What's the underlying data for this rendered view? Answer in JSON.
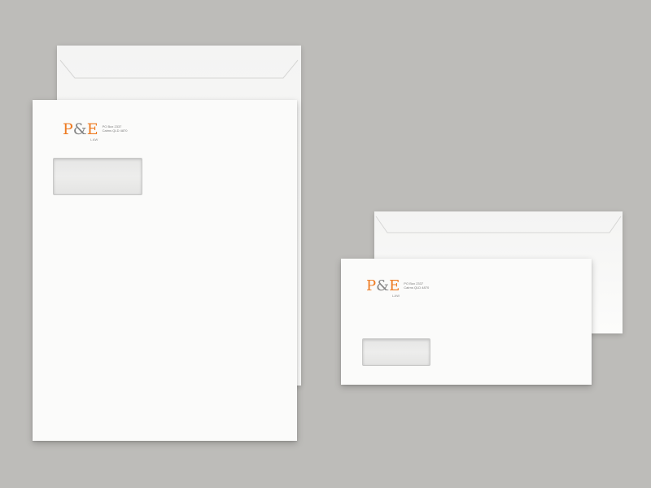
{
  "colors": {
    "background": "#bdbcb9",
    "paper": "#fbfbfa",
    "brand_orange": "#ee7b22",
    "brand_gray": "#868686"
  },
  "brand": {
    "logo_part1": "P",
    "logo_amp": "&",
    "logo_part2": "E",
    "logo_sub": "LAW"
  },
  "address": {
    "line1": "PO Box 2337",
    "line2": "Cairns QLD 4870"
  }
}
